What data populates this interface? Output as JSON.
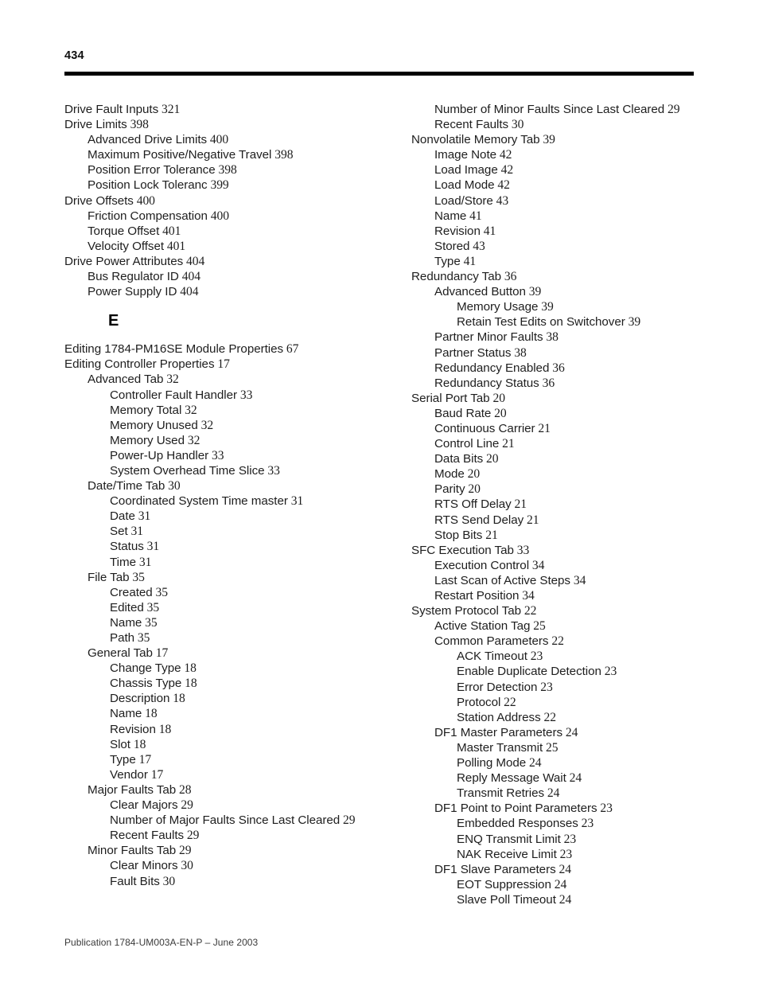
{
  "header": {
    "page_number": "434"
  },
  "section_letter": "E",
  "footer": {
    "publication": "Publication 1784-UM003A-EN-P – June 2003"
  },
  "left_column": [
    {
      "level": 0,
      "text": "Drive Fault Inputs",
      "page": "321"
    },
    {
      "level": 0,
      "text": "Drive Limits",
      "page": "398"
    },
    {
      "level": 1,
      "text": "Advanced Drive Limits",
      "page": "400"
    },
    {
      "level": 1,
      "text": "Maximum Positive/Negative Travel",
      "page": "398"
    },
    {
      "level": 1,
      "text": "Position Error Tolerance",
      "page": "398"
    },
    {
      "level": 1,
      "text": "Position Lock Toleranc",
      "page": "399"
    },
    {
      "level": 0,
      "text": "Drive Offsets",
      "page": "400"
    },
    {
      "level": 1,
      "text": "Friction Compensation",
      "page": "400"
    },
    {
      "level": 1,
      "text": "Torque Offset",
      "page": "401"
    },
    {
      "level": 1,
      "text": "Velocity Offset",
      "page": "401"
    },
    {
      "level": 0,
      "text": "Drive Power Attributes",
      "page": "404"
    },
    {
      "level": 1,
      "text": "Bus Regulator ID",
      "page": "404"
    },
    {
      "level": 1,
      "text": "Power Supply ID",
      "page": "404"
    }
  ],
  "left_column_after_letter": [
    {
      "level": 0,
      "text": "Editing 1784-PM16SE Module Properties",
      "page": "67"
    },
    {
      "level": 0,
      "text": "Editing Controller Properties",
      "page": "17"
    },
    {
      "level": 1,
      "text": "Advanced Tab",
      "page": "32"
    },
    {
      "level": 2,
      "text": "Controller Fault Handler",
      "page": "33"
    },
    {
      "level": 2,
      "text": "Memory Total",
      "page": "32"
    },
    {
      "level": 2,
      "text": "Memory Unused",
      "page": "32"
    },
    {
      "level": 2,
      "text": "Memory Used",
      "page": "32"
    },
    {
      "level": 2,
      "text": "Power-Up Handler",
      "page": "33"
    },
    {
      "level": 2,
      "text": "System Overhead Time Slice",
      "page": "33"
    },
    {
      "level": 1,
      "text": "Date/Time Tab",
      "page": "30"
    },
    {
      "level": 2,
      "text": "Coordinated System Time master",
      "page": "31"
    },
    {
      "level": 2,
      "text": "Date",
      "page": "31"
    },
    {
      "level": 2,
      "text": "Set",
      "page": "31"
    },
    {
      "level": 2,
      "text": "Status",
      "page": "31"
    },
    {
      "level": 2,
      "text": "Time",
      "page": "31"
    },
    {
      "level": 1,
      "text": "File Tab",
      "page": "35"
    },
    {
      "level": 2,
      "text": "Created",
      "page": "35"
    },
    {
      "level": 2,
      "text": "Edited",
      "page": "35"
    },
    {
      "level": 2,
      "text": "Name",
      "page": "35"
    },
    {
      "level": 2,
      "text": "Path",
      "page": "35"
    },
    {
      "level": 1,
      "text": "General Tab",
      "page": "17"
    },
    {
      "level": 2,
      "text": "Change Type",
      "page": "18"
    },
    {
      "level": 2,
      "text": "Chassis Type",
      "page": "18"
    },
    {
      "level": 2,
      "text": "Description",
      "page": "18"
    },
    {
      "level": 2,
      "text": "Name",
      "page": "18"
    },
    {
      "level": 2,
      "text": "Revision",
      "page": "18"
    },
    {
      "level": 2,
      "text": "Slot",
      "page": "18"
    },
    {
      "level": 2,
      "text": "Type",
      "page": "17"
    },
    {
      "level": 2,
      "text": "Vendor",
      "page": "17"
    },
    {
      "level": 1,
      "text": "Major Faults Tab",
      "page": "28"
    },
    {
      "level": 2,
      "text": "Clear Majors",
      "page": "29"
    },
    {
      "level": 2,
      "text": "Number of Major Faults Since Last Cleared",
      "page": "29"
    },
    {
      "level": 2,
      "text": "Recent Faults",
      "page": "29"
    },
    {
      "level": 1,
      "text": "Minor Faults Tab",
      "page": "29"
    },
    {
      "level": 2,
      "text": "Clear Minors",
      "page": "30"
    },
    {
      "level": 2,
      "text": "Fault Bits",
      "page": "30"
    }
  ],
  "right_column": [
    {
      "level": 1,
      "text": "Number of Minor Faults Since Last Cleared",
      "page": "29"
    },
    {
      "level": 1,
      "text": "Recent Faults",
      "page": "30"
    },
    {
      "level": 0,
      "text": "Nonvolatile Memory Tab",
      "page": "39"
    },
    {
      "level": 1,
      "text": "Image Note",
      "page": "42"
    },
    {
      "level": 1,
      "text": "Load Image",
      "page": "42"
    },
    {
      "level": 1,
      "text": "Load Mode",
      "page": "42"
    },
    {
      "level": 1,
      "text": "Load/Store",
      "page": "43"
    },
    {
      "level": 1,
      "text": "Name",
      "page": "41"
    },
    {
      "level": 1,
      "text": "Revision",
      "page": "41"
    },
    {
      "level": 1,
      "text": "Stored",
      "page": "43"
    },
    {
      "level": 1,
      "text": "Type",
      "page": "41"
    },
    {
      "level": 0,
      "text": "Redundancy Tab",
      "page": "36"
    },
    {
      "level": 1,
      "text": "Advanced Button",
      "page": "39"
    },
    {
      "level": 2,
      "text": "Memory Usage",
      "page": "39"
    },
    {
      "level": 2,
      "text": "Retain Test Edits on Switchover",
      "page": "39"
    },
    {
      "level": 1,
      "text": "Partner Minor Faults",
      "page": "38"
    },
    {
      "level": 1,
      "text": "Partner Status",
      "page": "38"
    },
    {
      "level": 1,
      "text": "Redundancy Enabled",
      "page": "36"
    },
    {
      "level": 1,
      "text": "Redundancy Status",
      "page": "36"
    },
    {
      "level": 0,
      "text": "Serial Port Tab",
      "page": "20"
    },
    {
      "level": 1,
      "text": "Baud Rate",
      "page": "20"
    },
    {
      "level": 1,
      "text": "Continuous Carrier",
      "page": "21"
    },
    {
      "level": 1,
      "text": "Control Line",
      "page": "21"
    },
    {
      "level": 1,
      "text": "Data Bits",
      "page": "20"
    },
    {
      "level": 1,
      "text": "Mode",
      "page": "20"
    },
    {
      "level": 1,
      "text": "Parity",
      "page": "20"
    },
    {
      "level": 1,
      "text": "RTS Off Delay",
      "page": "21"
    },
    {
      "level": 1,
      "text": "RTS Send Delay",
      "page": "21"
    },
    {
      "level": 1,
      "text": "Stop Bits",
      "page": "21"
    },
    {
      "level": 0,
      "text": "SFC Execution Tab",
      "page": "33"
    },
    {
      "level": 1,
      "text": "Execution Control",
      "page": "34"
    },
    {
      "level": 1,
      "text": "Last Scan of Active Steps",
      "page": "34"
    },
    {
      "level": 1,
      "text": "Restart Position",
      "page": "34"
    },
    {
      "level": 0,
      "text": "System Protocol Tab",
      "page": "22"
    },
    {
      "level": 1,
      "text": "Active Station Tag",
      "page": "25"
    },
    {
      "level": 1,
      "text": "Common Parameters",
      "page": "22"
    },
    {
      "level": 2,
      "text": "ACK Timeout",
      "page": "23"
    },
    {
      "level": 2,
      "text": "Enable Duplicate Detection",
      "page": "23"
    },
    {
      "level": 2,
      "text": "Error Detection",
      "page": "23"
    },
    {
      "level": 2,
      "text": "Protocol",
      "page": "22"
    },
    {
      "level": 2,
      "text": "Station Address",
      "page": "22"
    },
    {
      "level": 1,
      "text": "DF1 Master Parameters",
      "page": "24"
    },
    {
      "level": 2,
      "text": "Master Transmit",
      "page": "25"
    },
    {
      "level": 2,
      "text": "Polling Mode",
      "page": "24"
    },
    {
      "level": 2,
      "text": "Reply Message Wait",
      "page": "24"
    },
    {
      "level": 2,
      "text": "Transmit Retries",
      "page": "24"
    },
    {
      "level": 1,
      "text": "DF1 Point to Point Parameters",
      "page": "23"
    },
    {
      "level": 2,
      "text": "Embedded Responses",
      "page": "23"
    },
    {
      "level": 2,
      "text": "ENQ Transmit Limit",
      "page": "23"
    },
    {
      "level": 2,
      "text": "NAK Receive Limit",
      "page": "23"
    },
    {
      "level": 1,
      "text": "DF1 Slave Parameters",
      "page": "24"
    },
    {
      "level": 2,
      "text": "EOT Suppression",
      "page": "24"
    },
    {
      "level": 2,
      "text": "Slave Poll Timeout",
      "page": "24"
    }
  ]
}
